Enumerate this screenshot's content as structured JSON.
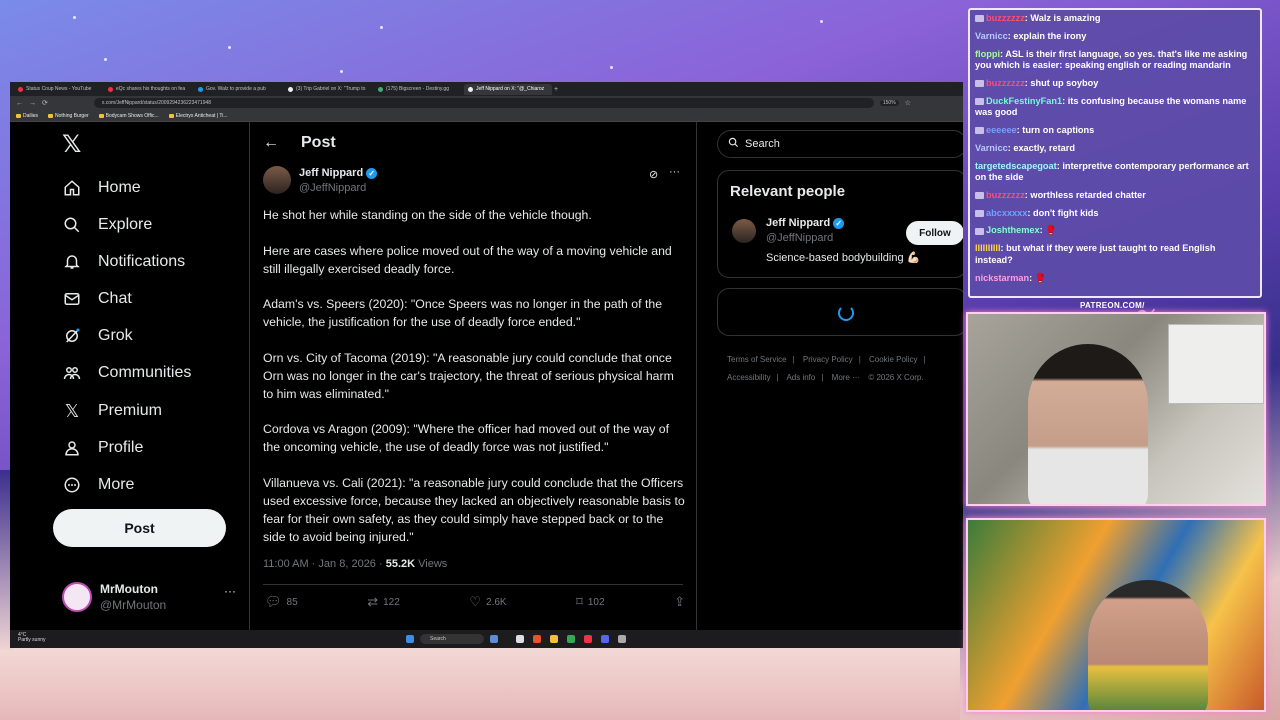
{
  "browser": {
    "tabs": [
      {
        "label": "Status Coup News - YouTube",
        "active": false
      },
      {
        "label": "eQc shares his thoughts on fea",
        "active": false
      },
      {
        "label": "Gov. Walz to provide a pub",
        "active": false
      },
      {
        "label": "(3) Trip Gabriel on X: \"Trump to",
        "active": false
      },
      {
        "label": "(175) Bigscreen - Destiny.gg",
        "active": false
      },
      {
        "label": "Jeff Nippard on X: \"@_Chiaroz",
        "active": true
      }
    ],
    "url": "x.com/JeffNippard/status/2009294236223471948",
    "zoom": "150%",
    "bookmarks": [
      "Dailies",
      "Nothing Burger",
      "Bodycam Shows Offic...",
      "Electryx Anticheat | Ti..."
    ]
  },
  "nav": {
    "items": [
      {
        "label": "Home",
        "icon": "home-icon"
      },
      {
        "label": "Explore",
        "icon": "search-icon"
      },
      {
        "label": "Notifications",
        "icon": "bell-icon"
      },
      {
        "label": "Chat",
        "icon": "mail-icon"
      },
      {
        "label": "Grok",
        "icon": "grok-icon"
      },
      {
        "label": "Communities",
        "icon": "people-icon"
      },
      {
        "label": "Premium",
        "icon": "x-icon"
      },
      {
        "label": "Profile",
        "icon": "person-icon"
      },
      {
        "label": "More",
        "icon": "more-circle-icon"
      }
    ],
    "post_button": "Post",
    "account": {
      "name": "MrMouton",
      "handle": "@MrMouton"
    }
  },
  "main": {
    "header": "Post",
    "author": {
      "name": "Jeff Nippard",
      "handle": "@JeffNippard"
    },
    "paragraphs": [
      "He shot her while standing on the side of the vehicle though.",
      "Here are cases where police moved out of the way of a moving vehicle and still illegally exercised deadly force.",
      "Adam's vs. Speers (2020): \"Once Speers was no longer in the path of the vehicle, the justification for the use of deadly force ended.\"",
      "Orn vs. City of Tacoma (2019): \"A reasonable jury could conclude that once Orn was no longer in the car's trajectory, the threat of serious physical harm to him was eliminated.\"",
      "Cordova vs Aragon (2009): \"Where the officer had moved out of the way of the oncoming vehicle, the use of deadly force was not justified.\"",
      "Villanueva vs. Cali (2021): \"a reasonable jury could conclude that the Officers used excessive force, because they lacked an objectively reasonable basis to fear for their own safety, as they could simply have stepped back or to the side to avoid being injured.\""
    ],
    "timestamp": "11:00 AM · Jan 8, 2026 · ",
    "views_count": "55.2K",
    "views_label": " Views",
    "actions": {
      "replies": "85",
      "reposts": "122",
      "likes": "2.6K",
      "bookmarks": "102"
    }
  },
  "right": {
    "search_placeholder": "Search",
    "relevant_title": "Relevant people",
    "person": {
      "name": "Jeff Nippard",
      "handle": "@JeffNippard",
      "bio": "Science-based bodybuilding 💪🏻",
      "follow": "Follow"
    },
    "footer": [
      "Terms of Service",
      "|",
      "Privacy Policy",
      "|",
      "Cookie Policy",
      "|",
      "Accessibility",
      "|",
      "Ads info",
      "|",
      "More ···",
      "© 2026 X Corp."
    ]
  },
  "taskbar": {
    "weather_temp": "4°C",
    "weather_desc": "Partly sunny",
    "search": "Search"
  },
  "chat": {
    "messages": [
      {
        "user": "buzzzzzz",
        "color": "#ff4d6d",
        "text": "Walz is amazing"
      },
      {
        "user": "Varnicc",
        "color": "#b9c8ff",
        "text": "explain the irony"
      },
      {
        "user": "floppi",
        "color": "#9fffa0",
        "text": "ASL is their first language, so yes. that's like me asking you which is easier: speaking english or reading mandarin"
      },
      {
        "user": "buzzzzzz",
        "color": "#ff4d6d",
        "text": "shut up soyboy"
      },
      {
        "user": "DuckFestinyFan1",
        "color": "#6fffd1",
        "text": "its confusing because the womans name was good"
      },
      {
        "user": "eeeeee",
        "color": "#7f9cff",
        "text": "turn on captions"
      },
      {
        "user": "Varnicc",
        "color": "#b9c8ff",
        "text": "exactly, retard"
      },
      {
        "user": "targetedscapegoat",
        "color": "#9ff7ff",
        "text": "interpretive contemporary performance art on the side"
      },
      {
        "user": "buzzzzzz",
        "color": "#ff4d6d",
        "text": "worthless retarded chatter"
      },
      {
        "user": "abcxxxxx",
        "color": "#6fa3ff",
        "text": "don't fight kids"
      },
      {
        "user": "Joshthemex",
        "color": "#7fffd4",
        "text": "🥊"
      },
      {
        "user": "IIIIIIIIII",
        "color": "#ffd24d",
        "text": "but what if they were just taught to read English instead?"
      },
      {
        "user": "nickstarman",
        "color": "#ff9ee0",
        "text": "🥊"
      }
    ]
  },
  "stream": {
    "brand": "PATREON.COM/"
  }
}
